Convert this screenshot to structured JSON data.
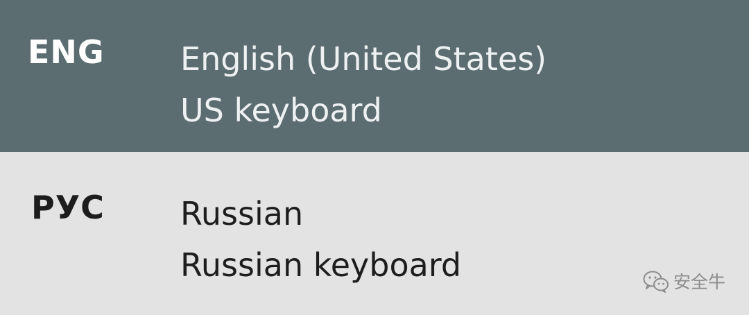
{
  "languages": [
    {
      "code": "ENG",
      "name": "English (United States)",
      "keyboard": "US keyboard",
      "selected": true
    },
    {
      "code": "РУС",
      "name": "Russian",
      "keyboard": "Russian keyboard",
      "selected": false
    }
  ],
  "watermark": {
    "text": "安全牛",
    "icon": "wechat-icon"
  },
  "colors": {
    "selected_background": "#5c6d71",
    "list_background": "#e3e3e3",
    "selected_text": "#ffffff",
    "text": "#1d1d1d"
  }
}
